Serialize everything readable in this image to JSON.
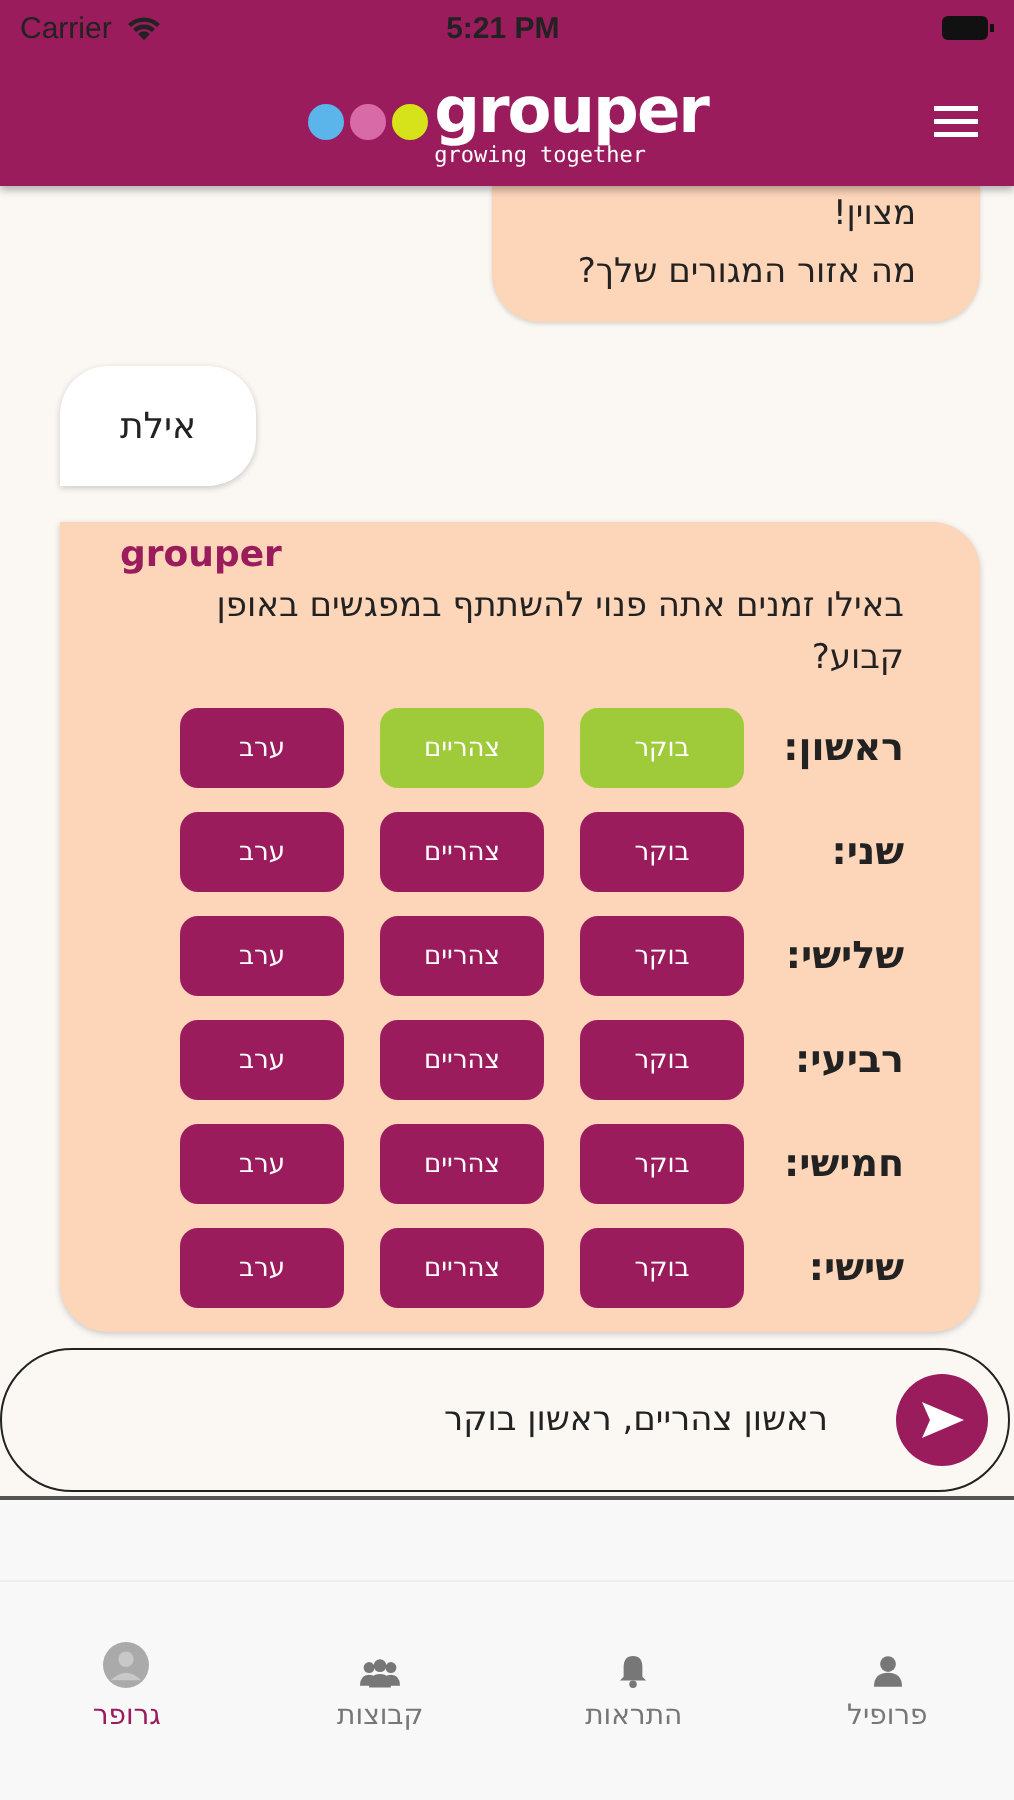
{
  "status_bar": {
    "carrier": "Carrier",
    "time": "5:21 PM"
  },
  "header": {
    "logo_text": "grouper",
    "tagline": "growing together"
  },
  "messages": [
    {
      "kind": "bot",
      "lines": [
        "מצוין!",
        "מה אזור המגורים שלך?"
      ]
    },
    {
      "kind": "user",
      "text": "אילת"
    },
    {
      "kind": "form",
      "sender": "grouper",
      "question": "באילו זמנים אתה פנוי להשתתף במפגשים באופן קבוע?",
      "rows": [
        {
          "day": "ראשון:",
          "options": [
            {
              "label": "בוקר",
              "selected": true
            },
            {
              "label": "צהריים",
              "selected": true
            },
            {
              "label": "ערב",
              "selected": false
            }
          ]
        },
        {
          "day": "שני:",
          "options": [
            {
              "label": "בוקר",
              "selected": false
            },
            {
              "label": "צהריים",
              "selected": false
            },
            {
              "label": "ערב",
              "selected": false
            }
          ]
        },
        {
          "day": "שלישי:",
          "options": [
            {
              "label": "בוקר",
              "selected": false
            },
            {
              "label": "צהריים",
              "selected": false
            },
            {
              "label": "ערב",
              "selected": false
            }
          ]
        },
        {
          "day": "רביעי:",
          "options": [
            {
              "label": "בוקר",
              "selected": false
            },
            {
              "label": "צהריים",
              "selected": false
            },
            {
              "label": "ערב",
              "selected": false
            }
          ]
        },
        {
          "day": "חמישי:",
          "options": [
            {
              "label": "בוקר",
              "selected": false
            },
            {
              "label": "צהריים",
              "selected": false
            },
            {
              "label": "ערב",
              "selected": false
            }
          ]
        },
        {
          "day": "שישי:",
          "options": [
            {
              "label": "בוקר",
              "selected": false
            },
            {
              "label": "צהריים",
              "selected": false
            },
            {
              "label": "ערב",
              "selected": false
            }
          ]
        }
      ]
    }
  ],
  "input": {
    "value": "ראשון צהריים, ראשון בוקר"
  },
  "tabs": [
    {
      "kind": "profile",
      "label": "פרופיל",
      "selected": false
    },
    {
      "kind": "alerts",
      "label": "התראות",
      "selected": false
    },
    {
      "kind": "groups",
      "label": "קבוצות",
      "selected": false
    },
    {
      "kind": "home",
      "label": "גרופר",
      "selected": true
    }
  ]
}
